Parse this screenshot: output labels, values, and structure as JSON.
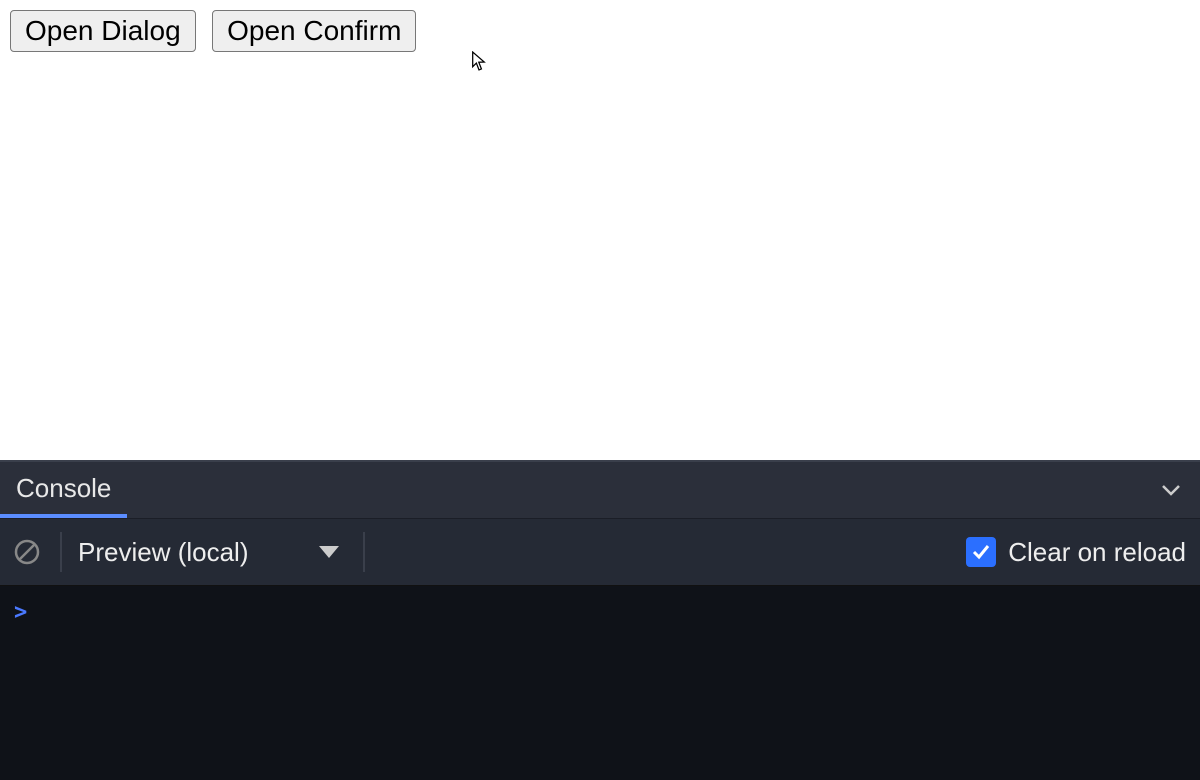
{
  "page": {
    "buttons": {
      "open_dialog": "Open Dialog",
      "open_confirm": "Open Confirm"
    }
  },
  "devtools": {
    "tabs": {
      "console": "Console"
    },
    "toolbar": {
      "context": "Preview (local)",
      "clear_on_reload_label": "Clear on reload",
      "clear_on_reload_checked": true
    },
    "console": {
      "prompt": ">"
    },
    "colors": {
      "tab_underline": "#5b8dff",
      "checkbox_checked_bg": "#2b6fff"
    }
  }
}
